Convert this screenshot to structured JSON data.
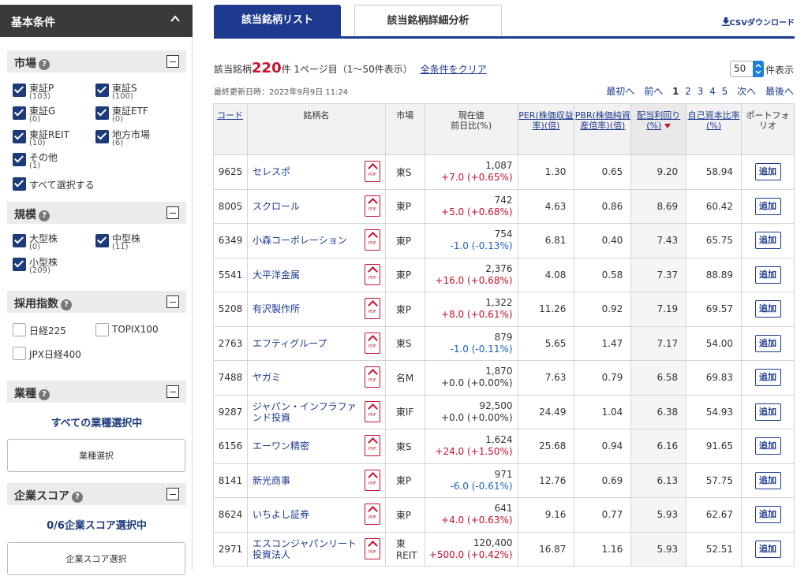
{
  "sidebar": {
    "title": "基本条件",
    "market": {
      "title": "市場",
      "items": [
        {
          "label": "東証P",
          "count": "(103)",
          "checked": true
        },
        {
          "label": "東証S",
          "count": "(100)",
          "checked": true
        },
        {
          "label": "東証G",
          "count": "(0)",
          "checked": true
        },
        {
          "label": "東証ETF",
          "count": "(0)",
          "checked": true
        },
        {
          "label": "東証REIT",
          "count": "(10)",
          "checked": true
        },
        {
          "label": "地方市場",
          "count": "(6)",
          "checked": true
        },
        {
          "label": "その他",
          "count": "(1)",
          "checked": true
        }
      ],
      "select_all": "すべて選択する"
    },
    "scale": {
      "title": "規模",
      "items": [
        {
          "label": "大型株",
          "count": "(0)",
          "checked": true
        },
        {
          "label": "中型株",
          "count": "(11)",
          "checked": true
        },
        {
          "label": "小型株",
          "count": "(209)",
          "checked": true
        }
      ]
    },
    "index": {
      "title": "採用指数",
      "items": [
        {
          "label": "日経225",
          "checked": false
        },
        {
          "label": "TOPIX100",
          "checked": false
        },
        {
          "label": "JPX日経400",
          "checked": false
        }
      ]
    },
    "industry": {
      "title": "業種",
      "note": "すべての業種選択中",
      "button": "業種選択"
    },
    "score": {
      "title": "企業スコア",
      "note": "0/6企業スコア選択中",
      "button": "企業スコア選択"
    }
  },
  "tabs": {
    "active": "該当銘柄リスト",
    "inactive": "該当銘柄詳細分析"
  },
  "csv_label": "CSVダウンロード",
  "summary": {
    "prefix": "該当銘柄",
    "count": "220",
    "suffix": "件 1ページ目（1〜50件表示）",
    "clear": "全条件をクリア",
    "per_page": "50",
    "per_page_label": "件表示",
    "updated": "最終更新日時：2022年9月9日 11:24"
  },
  "pager": {
    "first": "最初へ",
    "prev": "前へ",
    "pages": [
      "1",
      "2",
      "3",
      "4",
      "5"
    ],
    "current": "1",
    "next": "次へ",
    "last": "最後へ"
  },
  "table": {
    "headers": {
      "code": "コード",
      "name": "銘柄名",
      "market": "市場",
      "price": "現在値",
      "price_sub": "前日比(%)",
      "per": "PER(株価収益率)(倍)",
      "pbr": "PBR(株価純資産倍率)(倍)",
      "yield": "配当利回り(%)",
      "equity": "自己資本比率(%)",
      "portfolio": "ポートフォリオ"
    },
    "add_label": "追加",
    "pdf_label": "PDF",
    "rows": [
      {
        "code": "9625",
        "name": "セレスポ",
        "market": "東S",
        "price": "1,087",
        "change": "+7.0 (+0.65%)",
        "dir": "up",
        "per": "1.30",
        "pbr": "0.65",
        "yield": "9.20",
        "equity": "58.94"
      },
      {
        "code": "8005",
        "name": "スクロール",
        "market": "東P",
        "price": "742",
        "change": "+5.0 (+0.68%)",
        "dir": "up",
        "per": "4.63",
        "pbr": "0.86",
        "yield": "8.69",
        "equity": "60.42"
      },
      {
        "code": "6349",
        "name": "小森コーポレーション",
        "market": "東P",
        "price": "754",
        "change": "-1.0 (-0.13%)",
        "dir": "down",
        "per": "6.81",
        "pbr": "0.40",
        "yield": "7.43",
        "equity": "65.75"
      },
      {
        "code": "5541",
        "name": "大平洋金属",
        "market": "東P",
        "price": "2,376",
        "change": "+16.0 (+0.68%)",
        "dir": "up",
        "per": "4.08",
        "pbr": "0.58",
        "yield": "7.37",
        "equity": "88.89"
      },
      {
        "code": "5208",
        "name": "有沢製作所",
        "market": "東P",
        "price": "1,322",
        "change": "+8.0 (+0.61%)",
        "dir": "up",
        "per": "11.26",
        "pbr": "0.92",
        "yield": "7.19",
        "equity": "69.57"
      },
      {
        "code": "2763",
        "name": "エフティグループ",
        "market": "東S",
        "price": "879",
        "change": "-1.0 (-0.11%)",
        "dir": "down",
        "per": "5.65",
        "pbr": "1.47",
        "yield": "7.17",
        "equity": "54.00"
      },
      {
        "code": "7488",
        "name": "ヤガミ",
        "market": "名M",
        "price": "1,870",
        "change": "+0.0 (+0.00%)",
        "dir": "flat",
        "per": "7.63",
        "pbr": "0.79",
        "yield": "6.58",
        "equity": "69.83"
      },
      {
        "code": "9287",
        "name": "ジャパン・インフラファンド投資",
        "market": "東IF",
        "price": "92,500",
        "change": "+0.0 (+0.00%)",
        "dir": "flat",
        "per": "24.49",
        "pbr": "1.04",
        "yield": "6.38",
        "equity": "54.93"
      },
      {
        "code": "6156",
        "name": "エーワン精密",
        "market": "東S",
        "price": "1,624",
        "change": "+24.0 (+1.50%)",
        "dir": "up",
        "per": "25.68",
        "pbr": "0.94",
        "yield": "6.16",
        "equity": "91.65"
      },
      {
        "code": "8141",
        "name": "新光商事",
        "market": "東P",
        "price": "971",
        "change": "-6.0 (-0.61%)",
        "dir": "down",
        "per": "12.76",
        "pbr": "0.69",
        "yield": "6.13",
        "equity": "57.75"
      },
      {
        "code": "8624",
        "name": "いちよし証券",
        "market": "東P",
        "price": "641",
        "change": "+4.0 (+0.63%)",
        "dir": "up",
        "per": "9.16",
        "pbr": "0.77",
        "yield": "5.93",
        "equity": "62.67"
      },
      {
        "code": "2971",
        "name": "エスコンジャパンリート投資法人",
        "market": "東REIT",
        "price": "120,400",
        "change": "+500.0 (+0.42%)",
        "dir": "up",
        "per": "16.87",
        "pbr": "1.16",
        "yield": "5.93",
        "equity": "52.51"
      }
    ]
  }
}
